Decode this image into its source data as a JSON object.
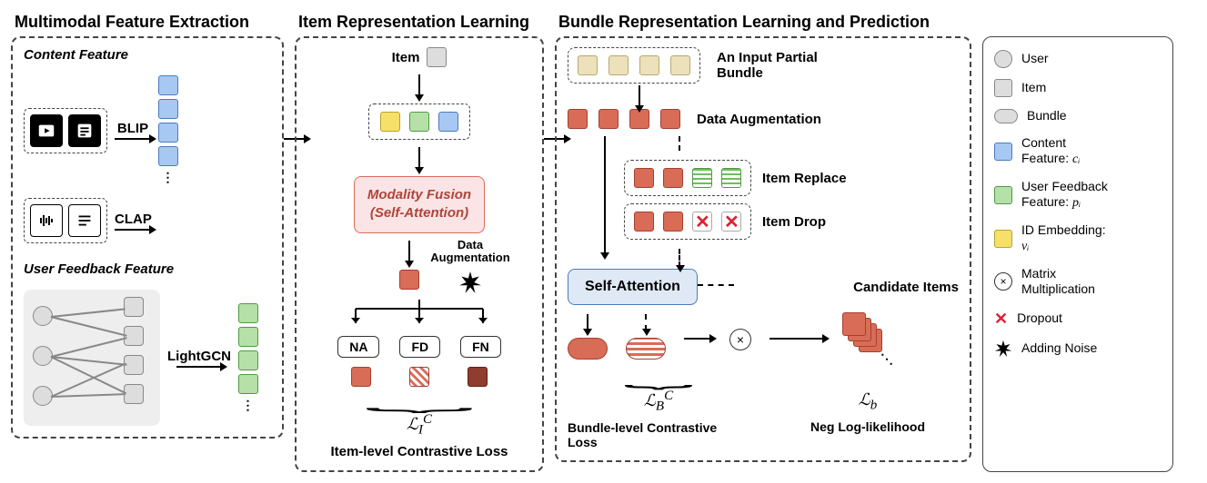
{
  "panels": {
    "left_title": "Multimodal Feature Extraction",
    "mid_title": "Item Representation Learning",
    "right_title": "Bundle Representation Learning and Prediction"
  },
  "left": {
    "content_feature_label": "Content Feature",
    "blip": "BLIP",
    "clap": "CLAP",
    "user_feedback_label": "User Feedback Feature",
    "lightgcn": "LightGCN"
  },
  "mid": {
    "item_label": "Item",
    "fusion_line1": "Modality Fusion",
    "fusion_line2": "(Self-Attention)",
    "data_aug": "Data\nAugmentation",
    "tags": [
      "NA",
      "FD",
      "FN"
    ],
    "loss_symbol": "ℒ",
    "loss_sub": "I",
    "loss_sup": "C",
    "loss_desc": "Item-level Contrastive Loss"
  },
  "right": {
    "input_bundle": "An Input Partial\nBundle",
    "data_aug": "Data Augmentation",
    "item_replace": "Item Replace",
    "item_drop": "Item Drop",
    "self_attention": "Self-Attention",
    "candidate": "Candidate Items",
    "loss_b_symbol": "ℒ",
    "loss_b_sub": "B",
    "loss_b_sup": "C",
    "loss_b_desc": "Bundle-level Contrastive Loss",
    "loss_nll_symbol": "ℒ",
    "loss_nll_sub": "b",
    "loss_nll_desc": "Neg Log-likelihood"
  },
  "legend": {
    "user": "User",
    "item": "Item",
    "bundle": "Bundle",
    "content_feature": "Content\nFeature:",
    "content_feature_sym": "cᵢ",
    "user_feedback": "User Feedback\nFeature:",
    "user_feedback_sym": "pᵢ",
    "id_embed": "ID Embedding:",
    "id_embed_sym": "vᵢ",
    "matmul": "Matrix\nMultiplication",
    "dropout": "Dropout",
    "noise": "Adding Noise"
  }
}
